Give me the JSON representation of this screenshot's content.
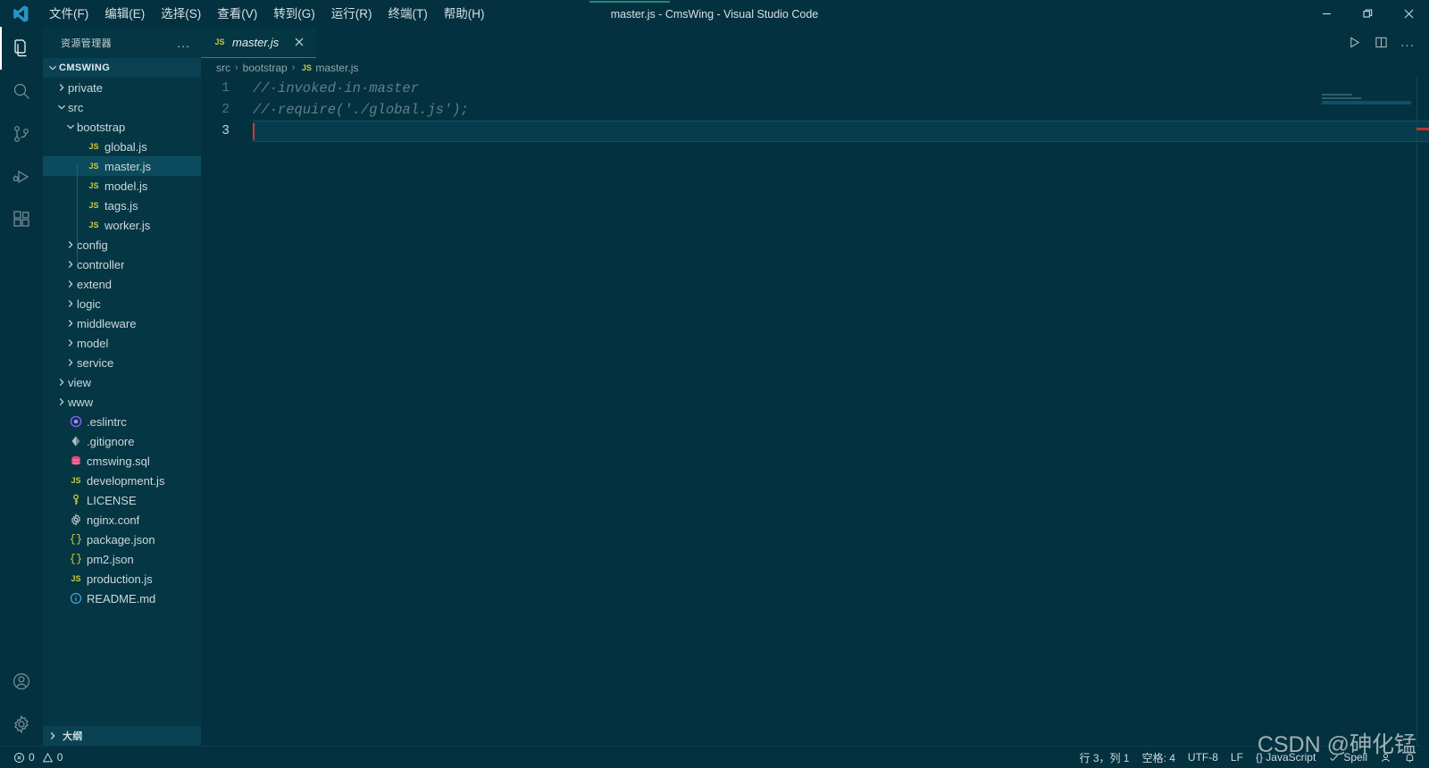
{
  "window": {
    "title": "master.js - CmsWing - Visual Studio Code",
    "minimize_label": "minimize-window",
    "restore_label": "restore-window",
    "close_label": "close-window"
  },
  "menu": [
    {
      "label": "文件(F)"
    },
    {
      "label": "编辑(E)"
    },
    {
      "label": "选择(S)"
    },
    {
      "label": "查看(V)"
    },
    {
      "label": "转到(G)"
    },
    {
      "label": "运行(R)"
    },
    {
      "label": "终端(T)"
    },
    {
      "label": "帮助(H)"
    }
  ],
  "activitybar": {
    "items": [
      {
        "name": "explorer",
        "icon": "files-icon",
        "active": true
      },
      {
        "name": "search",
        "icon": "search-icon",
        "active": false
      },
      {
        "name": "source-control",
        "icon": "source-control-icon",
        "active": false
      },
      {
        "name": "run-debug",
        "icon": "run-debug-icon",
        "active": false
      },
      {
        "name": "extensions",
        "icon": "extensions-icon",
        "active": false
      }
    ],
    "bottom": [
      {
        "name": "accounts",
        "icon": "account-icon"
      },
      {
        "name": "manage",
        "icon": "gear-icon"
      }
    ]
  },
  "sidebar": {
    "header_title": "资源管理器",
    "more_actions": "...",
    "outline_label": "大纲",
    "tree": [
      {
        "label": "CMSWING",
        "kind": "root",
        "indent": 0,
        "expanded": true,
        "icon": "chevron-down-icon"
      },
      {
        "label": "private",
        "kind": "folder",
        "indent": 1,
        "expanded": false,
        "icon": "chevron-right-icon"
      },
      {
        "label": "src",
        "kind": "folder",
        "indent": 1,
        "expanded": true,
        "icon": "chevron-down-icon"
      },
      {
        "label": "bootstrap",
        "kind": "folder",
        "indent": 2,
        "expanded": true,
        "icon": "chevron-down-icon"
      },
      {
        "label": "global.js",
        "kind": "file",
        "indent": 3,
        "icon": "js-icon"
      },
      {
        "label": "master.js",
        "kind": "file",
        "indent": 3,
        "icon": "js-icon",
        "selected": true
      },
      {
        "label": "model.js",
        "kind": "file",
        "indent": 3,
        "icon": "js-icon"
      },
      {
        "label": "tags.js",
        "kind": "file",
        "indent": 3,
        "icon": "js-icon"
      },
      {
        "label": "worker.js",
        "kind": "file",
        "indent": 3,
        "icon": "js-icon"
      },
      {
        "label": "config",
        "kind": "folder",
        "indent": 2,
        "expanded": false,
        "icon": "chevron-right-icon"
      },
      {
        "label": "controller",
        "kind": "folder",
        "indent": 2,
        "expanded": false,
        "icon": "chevron-right-icon"
      },
      {
        "label": "extend",
        "kind": "folder",
        "indent": 2,
        "expanded": false,
        "icon": "chevron-right-icon"
      },
      {
        "label": "logic",
        "kind": "folder",
        "indent": 2,
        "expanded": false,
        "icon": "chevron-right-icon"
      },
      {
        "label": "middleware",
        "kind": "folder",
        "indent": 2,
        "expanded": false,
        "icon": "chevron-right-icon"
      },
      {
        "label": "model",
        "kind": "folder",
        "indent": 2,
        "expanded": false,
        "icon": "chevron-right-icon"
      },
      {
        "label": "service",
        "kind": "folder",
        "indent": 2,
        "expanded": false,
        "icon": "chevron-right-icon"
      },
      {
        "label": "view",
        "kind": "folder",
        "indent": 1,
        "expanded": false,
        "icon": "chevron-right-icon"
      },
      {
        "label": "www",
        "kind": "folder",
        "indent": 1,
        "expanded": false,
        "icon": "chevron-right-icon"
      },
      {
        "label": ".eslintrc",
        "kind": "file",
        "indent": 1,
        "icon": "eslint-icon"
      },
      {
        "label": ".gitignore",
        "kind": "file",
        "indent": 1,
        "icon": "git-icon"
      },
      {
        "label": "cmswing.sql",
        "kind": "file",
        "indent": 1,
        "icon": "database-icon"
      },
      {
        "label": "development.js",
        "kind": "file",
        "indent": 1,
        "icon": "js-icon"
      },
      {
        "label": "LICENSE",
        "kind": "file",
        "indent": 1,
        "icon": "key-icon"
      },
      {
        "label": "nginx.conf",
        "kind": "file",
        "indent": 1,
        "icon": "gear-icon"
      },
      {
        "label": "package.json",
        "kind": "file",
        "indent": 1,
        "icon": "json-icon"
      },
      {
        "label": "pm2.json",
        "kind": "file",
        "indent": 1,
        "icon": "json-icon"
      },
      {
        "label": "production.js",
        "kind": "file",
        "indent": 1,
        "icon": "js-icon"
      },
      {
        "label": "README.md",
        "kind": "file",
        "indent": 1,
        "icon": "info-icon"
      }
    ]
  },
  "editor": {
    "tab": {
      "title": "master.js",
      "icon": "js-icon",
      "close": "close-tab-icon",
      "preview": true
    },
    "actions": [
      {
        "name": "run-file-button",
        "icon": "play-icon"
      },
      {
        "name": "split-editor-button",
        "icon": "split-editor-icon"
      },
      {
        "name": "more-actions-button",
        "icon": "ellipsis-icon",
        "label": "..."
      }
    ],
    "breadcrumbs": [
      {
        "label": "src",
        "icon": null
      },
      {
        "label": "bootstrap",
        "icon": null
      },
      {
        "label": "master.js",
        "icon": "js-icon"
      }
    ],
    "lines": [
      {
        "number": "1",
        "text": "// invoked in master",
        "type": "comment",
        "current": false
      },
      {
        "number": "2",
        "text": "// require('./global.js');",
        "type": "comment",
        "current": false
      },
      {
        "number": "3",
        "text": "",
        "type": "empty",
        "current": true
      }
    ]
  },
  "statusbar": {
    "left": [
      {
        "name": "problems",
        "icon": "error-icon",
        "errors": "0",
        "warn_icon": "warning-icon",
        "warnings": "0"
      }
    ],
    "right": [
      {
        "name": "cursor-position",
        "label": "行 3，列 1"
      },
      {
        "name": "indentation",
        "label": "空格: 4"
      },
      {
        "name": "encoding",
        "label": "UTF-8"
      },
      {
        "name": "eol",
        "label": "LF"
      },
      {
        "name": "language-mode",
        "label": "{} JavaScript"
      },
      {
        "name": "spell-checker",
        "label": "Spell"
      },
      {
        "name": "accounts",
        "label": ""
      },
      {
        "name": "notifications",
        "label": ""
      }
    ]
  },
  "watermark": {
    "text": "CSDN @砷化锰"
  },
  "colors": {
    "background": "#04313f",
    "sidebar": "#053643",
    "accent": "#1f8a7a",
    "selection": "#0b4b5d",
    "cursor": "#d13438",
    "js_yellow": "#cbcb41",
    "comment": "#5f7f8a"
  }
}
